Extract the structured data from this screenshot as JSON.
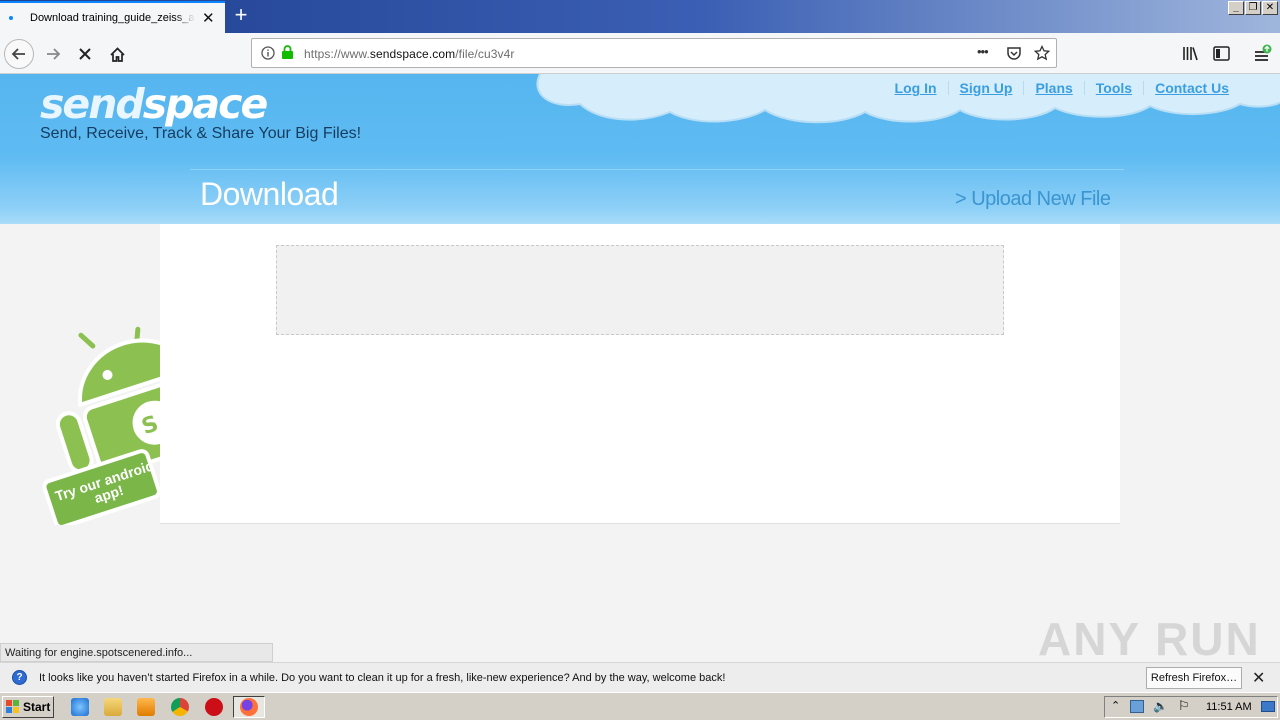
{
  "browser": {
    "tab_title": "Download training_guide_zeiss_acc",
    "tab_close": "✕",
    "new_tab": "+",
    "url_prefix": "https://www.",
    "url_host": "sendspace.com",
    "url_path": "/file/cu3v4r",
    "page_actions": "•••",
    "window_buttons": [
      "_",
      "❐",
      "✕"
    ]
  },
  "site": {
    "logo_part1": "send",
    "logo_part2": "space",
    "tagline": "Send, Receive, Track & Share Your Big Files!",
    "nav": [
      "Log In",
      "Sign Up",
      "Plans",
      "Tools",
      "Contact Us"
    ],
    "page_title": "Download",
    "upload_link": "> Upload New File",
    "android_promo": "Try our android app!"
  },
  "status_text": "Waiting for engine.spotscenered.info...",
  "notification": {
    "message": "It looks like you haven’t started Firefox in a while. Do you want to clean it up for a fresh, like-new experience? And by the way, welcome back!",
    "button": "Refresh Firefox…",
    "close": "✕"
  },
  "taskbar": {
    "start": "Start",
    "clock": "11:51 AM"
  },
  "watermark": "ANY RUN",
  "colors": {
    "header_blue": "#56b5ef",
    "link_blue": "#3a9ee0",
    "android_green": "#8cc152"
  }
}
